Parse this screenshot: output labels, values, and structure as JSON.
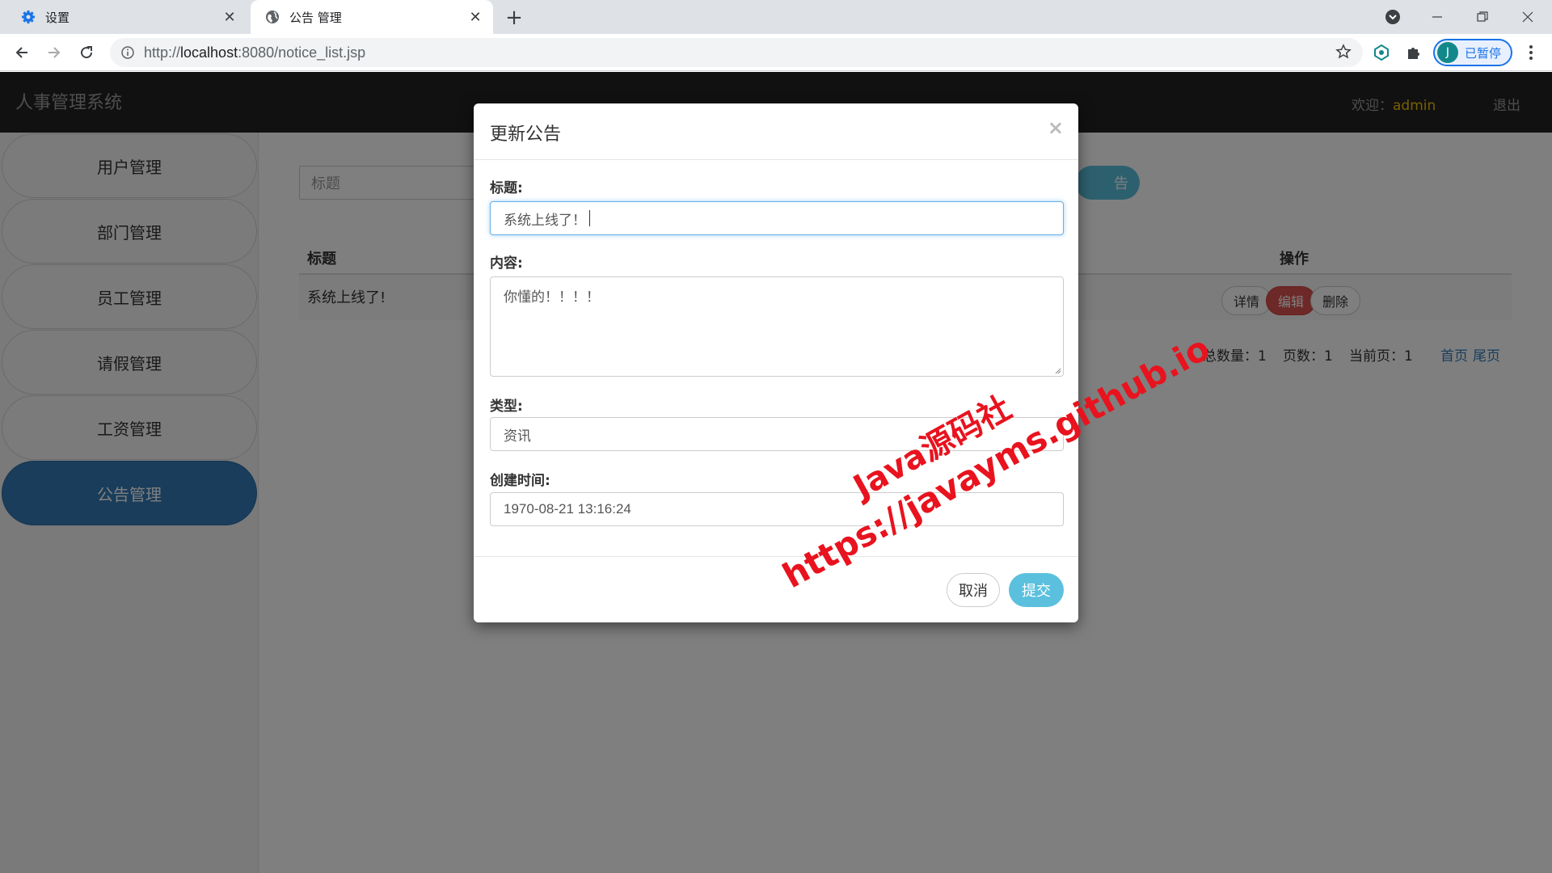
{
  "browser": {
    "tabs": [
      {
        "title": "设置",
        "icon": "gear-icon",
        "active": false
      },
      {
        "title": "公告 管理",
        "icon": "globe-icon",
        "active": true
      }
    ],
    "url_prefix": "http://",
    "url_host": "localhost",
    "url_rest": ":8080/notice_list.jsp",
    "profile_initial": "J",
    "profile_status": "已暂停"
  },
  "app": {
    "brand": "人事管理系统",
    "welcome_label": "欢迎：",
    "username": "admin",
    "logout": "退出"
  },
  "sidebar": {
    "items": [
      {
        "label": "用户管理",
        "active": false
      },
      {
        "label": "部门管理",
        "active": false
      },
      {
        "label": "员工管理",
        "active": false
      },
      {
        "label": "请假管理",
        "active": false
      },
      {
        "label": "工资管理",
        "active": false
      },
      {
        "label": "公告管理",
        "active": true
      }
    ]
  },
  "main": {
    "search_placeholder": "标题",
    "add_button": "告",
    "table": {
      "columns": [
        "标题",
        "操作"
      ],
      "rows": [
        {
          "title": "系统上线了!",
          "actions": [
            "详情",
            "编辑",
            "删除"
          ]
        }
      ]
    },
    "pager": {
      "total": "总数量：1",
      "pages": "页数：1",
      "current": "当前页：1",
      "first": "首页",
      "last": "尾页"
    }
  },
  "modal": {
    "title": "更新公告",
    "close": "×",
    "fields": {
      "title_label": "标题:",
      "title_value": "系统上线了！",
      "content_label": "内容:",
      "content_value": "你懂的！！！！",
      "type_label": "类型:",
      "type_value": "资讯",
      "time_label": "创建时间:",
      "time_value": "1970-08-21 13:16:24"
    },
    "cancel": "取消",
    "submit": "提交"
  },
  "watermark": {
    "line1": "Java源码社",
    "line2": "https://javayms.github.io"
  },
  "colors": {
    "header_bg": "#222222",
    "sidebar_active": "#337ab7",
    "info_button": "#5bc0de",
    "danger_button": "#d9534f",
    "username": "#f0c000",
    "watermark": "#e8131e"
  }
}
